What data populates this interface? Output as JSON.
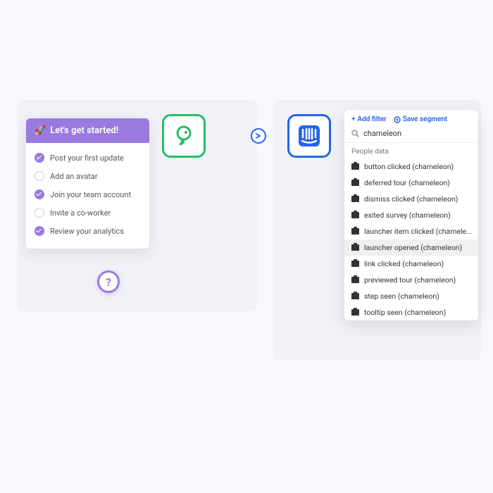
{
  "checklist": {
    "title": "Let's get started!",
    "rocket": "🚀",
    "items": [
      {
        "label": "Post your first update",
        "done": true
      },
      {
        "label": "Add an avatar",
        "done": false
      },
      {
        "label": "Join your team account",
        "done": true
      },
      {
        "label": "Invite a co-worker",
        "done": false
      },
      {
        "label": "Review your analytics",
        "done": true
      }
    ]
  },
  "help": {
    "label": "?"
  },
  "dropdown": {
    "add_filter": "Add filter",
    "save_segment": "Save segment",
    "search_value": "chameleon",
    "section": "People data",
    "options": [
      {
        "label": "button clicked (chameleon)"
      },
      {
        "label": "deferred tour (chameleon)"
      },
      {
        "label": "dismiss clicked (chameleon)"
      },
      {
        "label": "exited survey (chameleon)"
      },
      {
        "label": "launcher item clicked (chamele..."
      },
      {
        "label": "launcher opened (chameleon)",
        "hover": true
      },
      {
        "label": "link clicked (chameleon)"
      },
      {
        "label": "previewed tour (chameleon)"
      },
      {
        "label": "step seen (chameleon)"
      },
      {
        "label": "tooltip seen (chameleon)"
      }
    ]
  },
  "icons": {
    "chameleon": "chameleon-logo",
    "intercom": "intercom-logo"
  }
}
